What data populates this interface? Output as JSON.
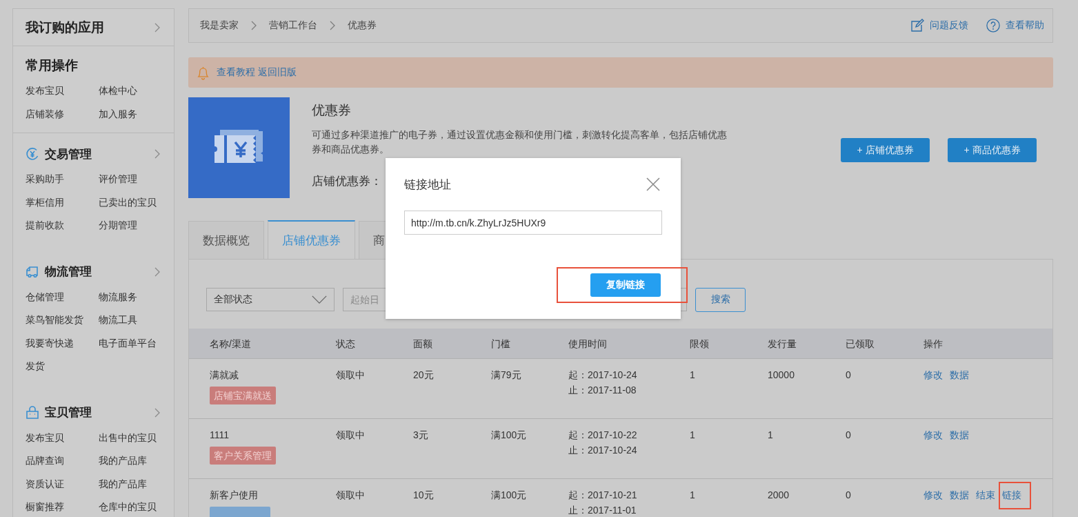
{
  "sidebar": {
    "sections": [
      {
        "title": "我订购的应用",
        "kind": "app"
      },
      {
        "title": "常用操作",
        "kind": "common",
        "items": [
          "发布宝贝",
          "体检中心",
          "店铺装修",
          "加入服务"
        ]
      },
      {
        "title": "交易管理",
        "kind": "module",
        "items": [
          "采购助手",
          "评价管理",
          "掌柜信用",
          "已卖出的宝贝",
          "提前收款",
          "分期管理"
        ]
      },
      {
        "title": "物流管理",
        "kind": "module",
        "items": [
          "仓储管理",
          "物流服务",
          "菜鸟智能发货",
          "物流工具",
          "我要寄快递",
          "电子面单平台",
          "发货"
        ]
      },
      {
        "title": "宝贝管理",
        "kind": "module",
        "items": [
          "发布宝贝",
          "出售中的宝贝",
          "品牌查询",
          "我的产品库",
          "资质认证",
          "我的产品库",
          "橱窗推荐",
          "仓库中的宝贝"
        ]
      }
    ]
  },
  "breadcrumb": [
    "我是卖家",
    "营销工作台",
    "优惠券"
  ],
  "header_links": [
    {
      "label": "问题反馈",
      "kind": "feedback"
    },
    {
      "label": "查看帮助",
      "kind": "help"
    }
  ],
  "notice": {
    "links": [
      "查看教程",
      "返回旧版"
    ]
  },
  "hero": {
    "title": "优惠券",
    "description": "可通过多种渠道推广的电子券，通过设置优惠金额和使用门槛，刺激转化提高客单，包括店铺优惠券和商品优惠券。",
    "summary": "店铺优惠券：",
    "buttons": [
      "+ 店铺优惠券",
      "+ 商品优惠券"
    ]
  },
  "tabs": [
    {
      "label": "数据概览",
      "selected": false
    },
    {
      "label": "店铺优惠券",
      "selected": true
    },
    {
      "label": "商",
      "selected": false
    }
  ],
  "filters": {
    "status": "全部状态",
    "date_placeholder": "起始日",
    "search": "搜索"
  },
  "table": {
    "columns": [
      "名称/渠道",
      "状态",
      "面额",
      "门槛",
      "使用时间",
      "限领",
      "发行量",
      "已领取",
      "操作"
    ],
    "rows": [
      {
        "name": "满就减",
        "tag": {
          "label": "店铺宝满就送",
          "color": "#c97d7b"
        },
        "status": "领取中",
        "amount": "20元",
        "threshold": "满79元",
        "start": "起：2017-10-24",
        "end": "止：2017-11-08",
        "limit": "1",
        "issued": "10000",
        "claimed": "0",
        "actions": [
          {
            "label": "修改",
            "highlighted": false
          },
          {
            "label": "数据",
            "highlighted": false
          }
        ]
      },
      {
        "name": "1111",
        "tag": {
          "label": "客户关系管理",
          "color": "#c97d7b"
        },
        "status": "领取中",
        "amount": "3元",
        "threshold": "满100元",
        "start": "起：2017-10-22",
        "end": "止：2017-10-24",
        "limit": "1",
        "issued": "1",
        "claimed": "0",
        "actions": [
          {
            "label": "修改",
            "highlighted": false
          },
          {
            "label": "数据",
            "highlighted": false
          }
        ]
      },
      {
        "name": "新客户使用",
        "tag": {
          "color": "#7ca6cf"
        },
        "status": "领取中",
        "amount": "10元",
        "threshold": "满100元",
        "start": "起：2017-10-21",
        "end": "止：2017-11-01",
        "limit": "1",
        "issued": "2000",
        "claimed": "0",
        "actions": [
          {
            "label": "修改",
            "highlighted": false
          },
          {
            "label": "数据",
            "highlighted": false
          },
          {
            "label": "结束",
            "highlighted": false
          },
          {
            "label": "链接",
            "highlighted": true
          }
        ]
      }
    ]
  },
  "dialog": {
    "title": "链接地址",
    "url": "http://m.tb.cn/k.ZhyLrJz5HUXr9",
    "button": "复制链接",
    "button_highlighted": true
  }
}
